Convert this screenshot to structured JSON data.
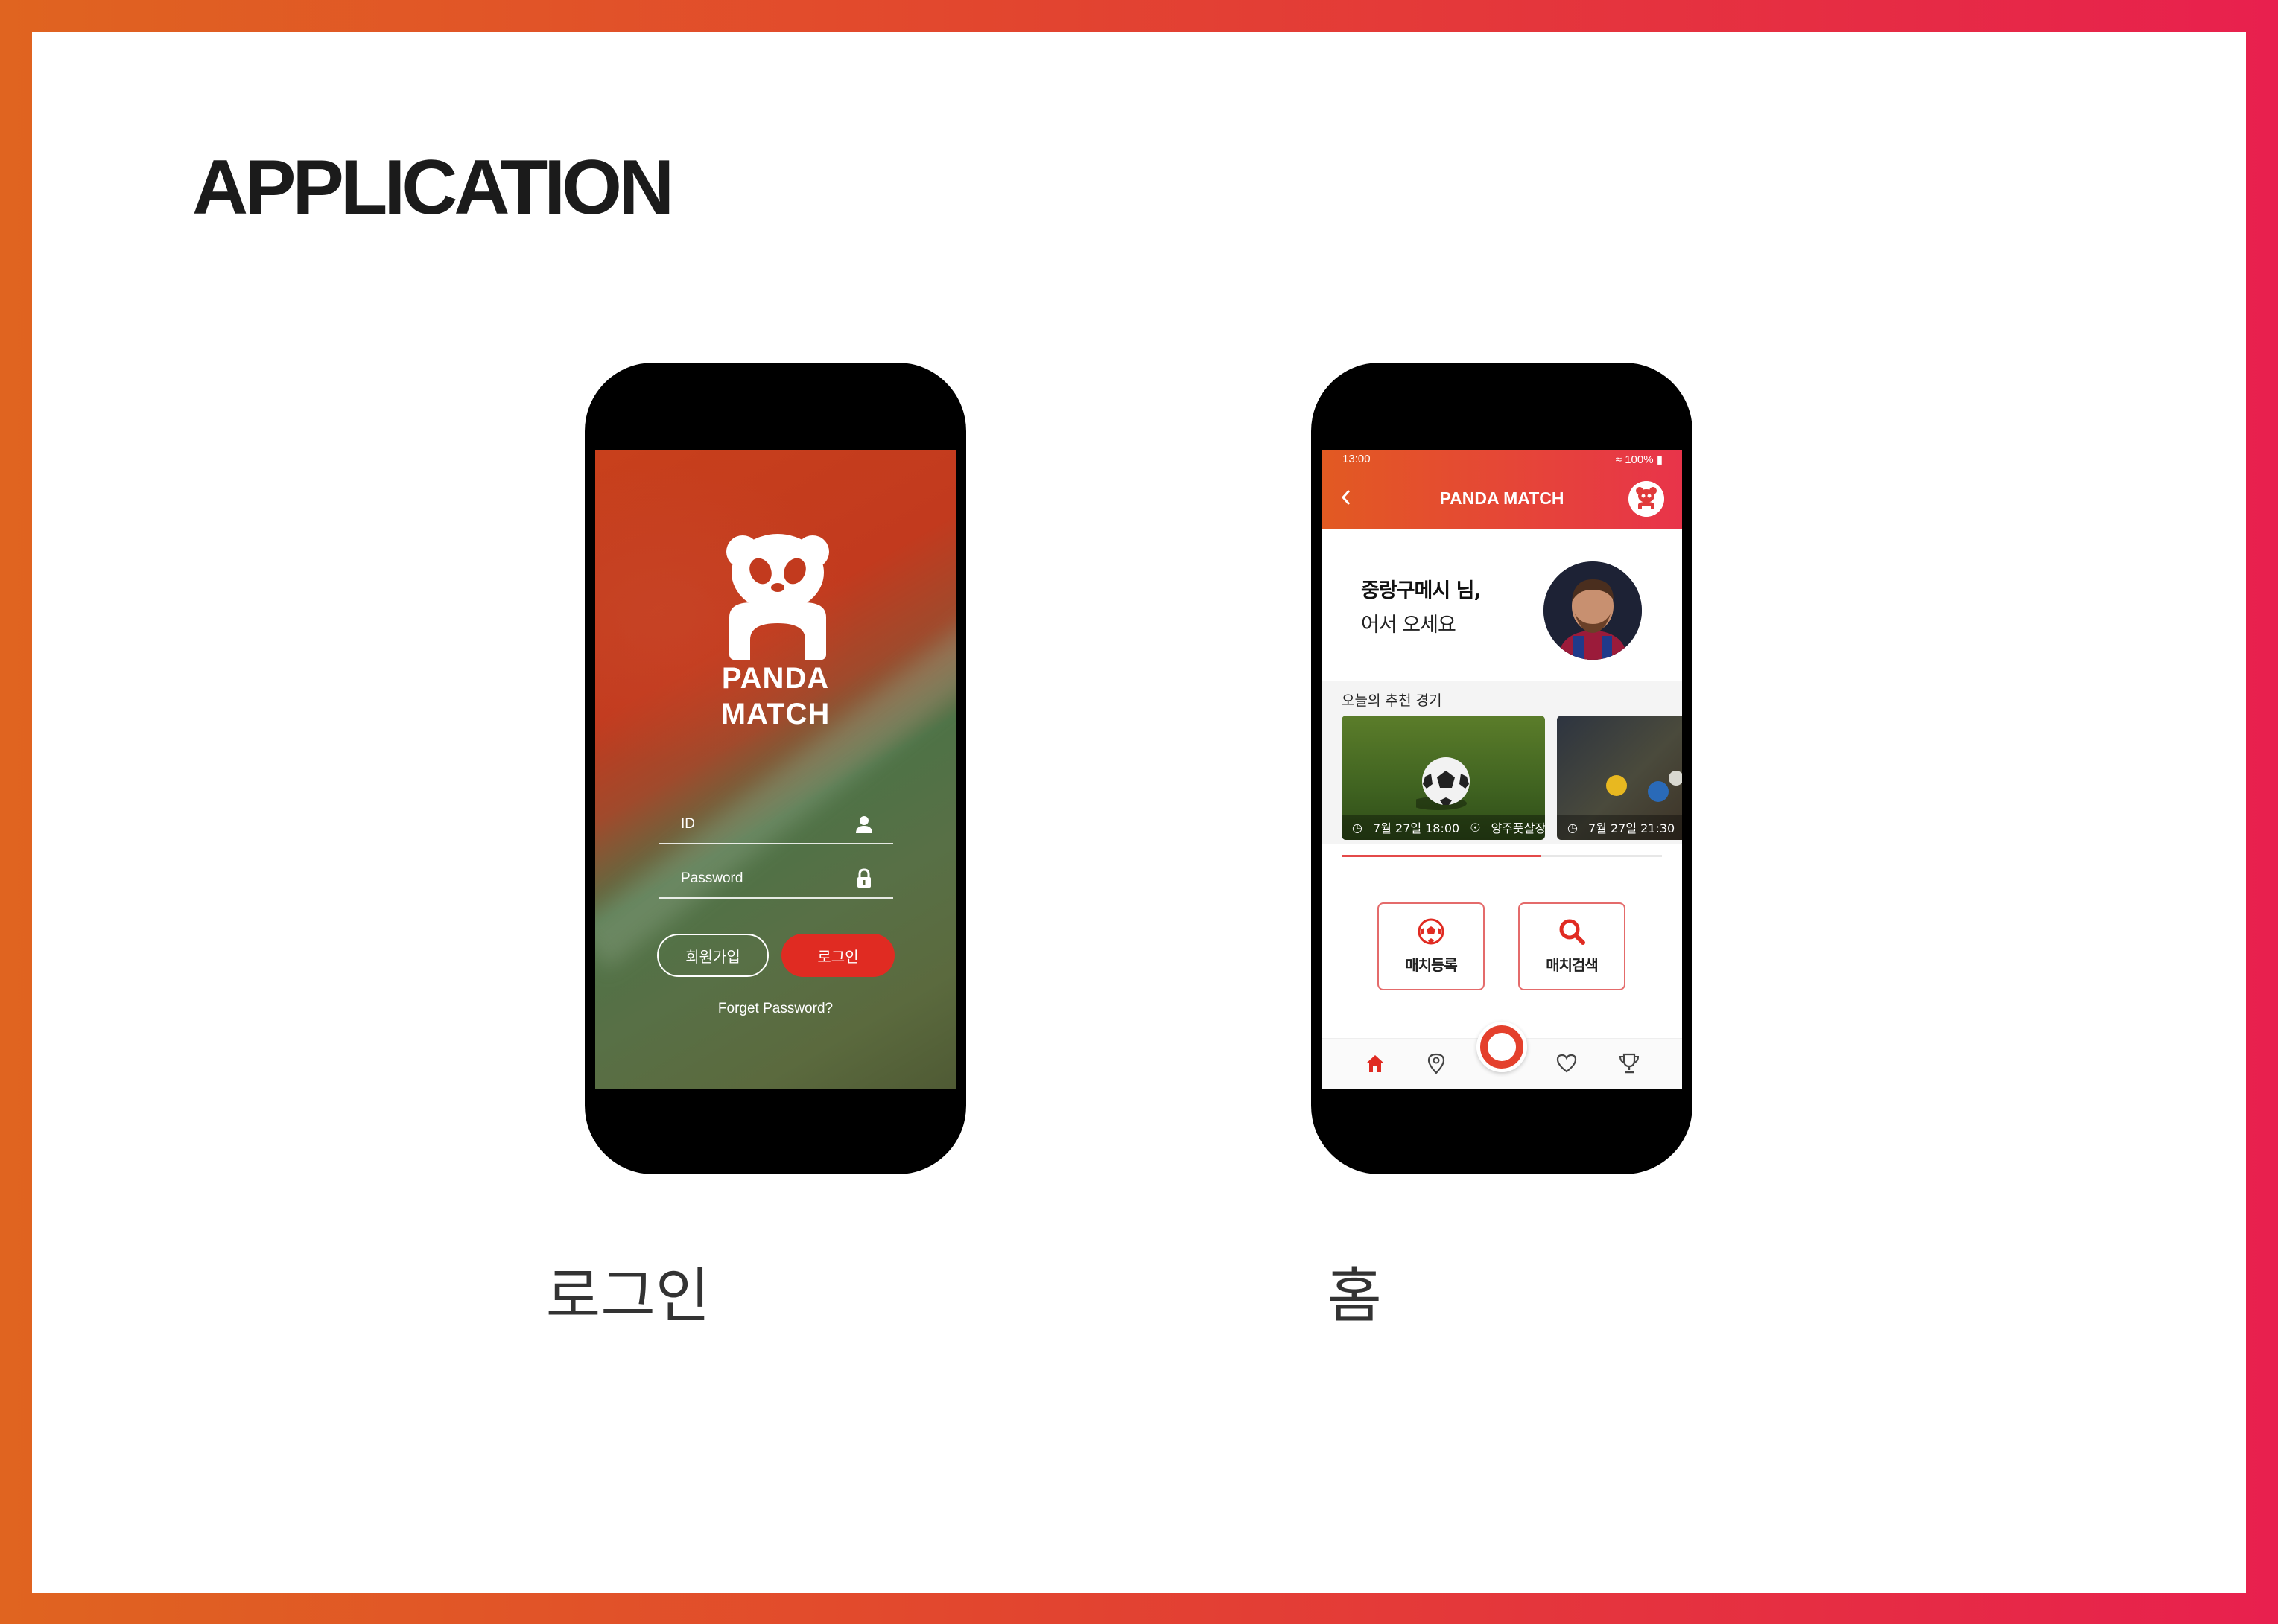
{
  "page": {
    "title": "APPLICATION"
  },
  "captions": {
    "login": "로그인",
    "home": "홈"
  },
  "login": {
    "brand_line1": "PANDA",
    "brand_line2": "MATCH",
    "id_placeholder": "ID",
    "password_placeholder": "Password",
    "signup_label": "회원가입",
    "login_label": "로그인",
    "forgot_label": "Forget Password?"
  },
  "home": {
    "status_time": "13:00",
    "status_battery": "100%",
    "brand": "PANDA MATCH",
    "greeting_name": "중랑구메시 님,",
    "greeting_sub": "어서 오세요",
    "section_title": "오늘의 추천 경기",
    "cards": [
      {
        "date": "7월 27일 18:00",
        "place": "양주풋살장"
      },
      {
        "date": "7월 27일 21:30",
        "place": ""
      }
    ],
    "actions": {
      "register": "매치등록",
      "search": "매치검색"
    },
    "nav": [
      "home-icon",
      "map-pin-icon",
      "heart-icon",
      "trophy-icon"
    ]
  },
  "colors": {
    "accent": "#e02b22",
    "gradient_start": "#e06420",
    "gradient_end": "#e8204e"
  }
}
